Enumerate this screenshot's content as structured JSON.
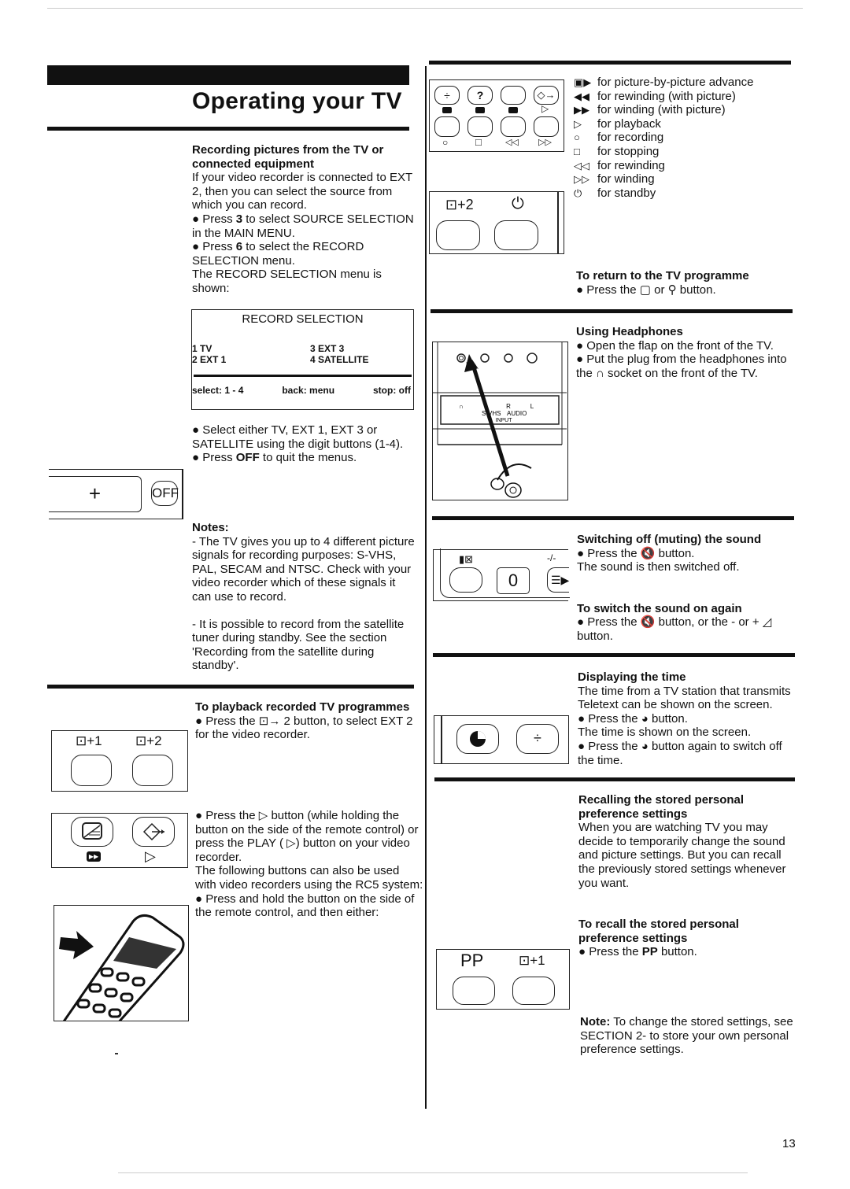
{
  "page": {
    "title": "Operating your TV",
    "page_number": "13"
  },
  "recording": {
    "heading": "Recording pictures from the TV or connected equipment",
    "intro": "If your video recorder is connected to EXT 2, then you can select the source from which you can record.",
    "step1_pre": "Press ",
    "step1_key": "3",
    "step1_post": " to select SOURCE SELECTION in the MAIN MENU.",
    "step2_pre": "Press ",
    "step2_key": "6",
    "step2_post": " to select the RECORD SELECTION menu.",
    "shown": "The RECORD SELECTION menu is shown:",
    "after1": "Select either TV, EXT 1, EXT 3 or SATELLITE using the digit buttons (1-4).",
    "after2_pre": "Press ",
    "after2_key": "OFF",
    "after2_post": " to quit the menus."
  },
  "record_menu": {
    "title": "RECORD SELECTION",
    "options": [
      "1 TV",
      "2 EXT 1",
      "3 EXT 3",
      "4 SATELLITE"
    ],
    "footer": [
      "select: 1 - 4",
      "back: menu",
      "stop: off"
    ]
  },
  "off_panel": {
    "plus": "+",
    "off": "OFF"
  },
  "notes": {
    "heading": "Notes:",
    "note1": "- The TV gives you up to 4 different picture signals for recording purposes: S-VHS, PAL, SECAM and NTSC. Check with your video recorder which of these signals it can use to record.",
    "note2": "- It is possible to record from the satellite tuner during standby. See the section 'Recording from the satellite during standby'."
  },
  "playback": {
    "heading": "To playback recorded TV programmes",
    "step1_pre": "Press the ",
    "step1_icon": "⊡→",
    "step1_post": " 2 button, to select EXT 2 for the video recorder.",
    "step2": "Press the ▷ button (while holding the button on the side of the remote control) or press the PLAY ( ▷) button on your video recorder.",
    "rc5": "The following buttons can also be used with video recorders using the RC5 system:",
    "step3": "Press and hold the button on the side of the remote control, and then either:"
  },
  "ext_panel": {
    "labels": [
      "⊡+1",
      "⊡+2"
    ]
  },
  "vcr_legend": [
    {
      "glyph": "▣▶",
      "text": "for picture-by-picture advance"
    },
    {
      "glyph": "◀◀",
      "text": "for rewinding (with picture)"
    },
    {
      "glyph": "▶▶",
      "text": "for winding (with picture)"
    },
    {
      "glyph": "▷",
      "text": "for playback"
    },
    {
      "glyph": "○",
      "text": "for recording"
    },
    {
      "glyph": "□",
      "text": "for stopping"
    },
    {
      "glyph": "◁◁",
      "text": "for rewinding"
    },
    {
      "glyph": "▷▷",
      "text": "for winding"
    },
    {
      "glyph": "⏻",
      "text": "for standby"
    }
  ],
  "vcr_panel": {
    "bottom_symbols": [
      "○",
      "□",
      "◁◁",
      "▷▷"
    ],
    "top_small": [
      "▣",
      "◀◀",
      "▶▶",
      "▷"
    ],
    "ext2": "⊡+2",
    "standby": "⏻"
  },
  "return_tv": {
    "heading": "To return to the TV programme",
    "step": "Press the ▢ or ⚲ button."
  },
  "headphones": {
    "heading": "Using Headphones",
    "step1": "Open the flap on the front of the TV.",
    "step2": "Put the plug from the headphones into the ∩ socket on the front of the TV.",
    "panel_labels": {
      "svhs": "S-VHS",
      "audio": "AUDIO",
      "input": "INPUT",
      "r": "R",
      "l": "L"
    }
  },
  "mute": {
    "heading": "Switching off (muting) the sound",
    "step": "Press the 🔇 button.",
    "result": "The sound is then switched off.",
    "heading2": "To switch the sound on again",
    "step2": "Press the 🔇 button, or the - or + ◿ button.",
    "panel_zero": "0",
    "panel_dash": "-/-"
  },
  "time": {
    "heading": "Displaying the time",
    "intro": "The time from a TV station that transmits Teletext can be shown on the screen.",
    "step1": "Press the ◕ button.",
    "result": "The time is shown on the screen.",
    "step2": "Press the ◕ button again to switch off the time."
  },
  "pp": {
    "heading": "Recalling the stored personal preference settings",
    "intro": "When you are watching TV you may decide to temporarily change the sound and picture settings. But you can recall the previously stored settings whenever you want.",
    "heading2": "To recall the stored personal preference settings",
    "step_pre": "Press the ",
    "step_key": "PP",
    "step_post": " button.",
    "note_label": "Note:",
    "note_text": " To change the stored settings, see SECTION 2- to store your own personal preference settings.",
    "panel_labels": [
      "PP",
      "⊡+1"
    ]
  }
}
